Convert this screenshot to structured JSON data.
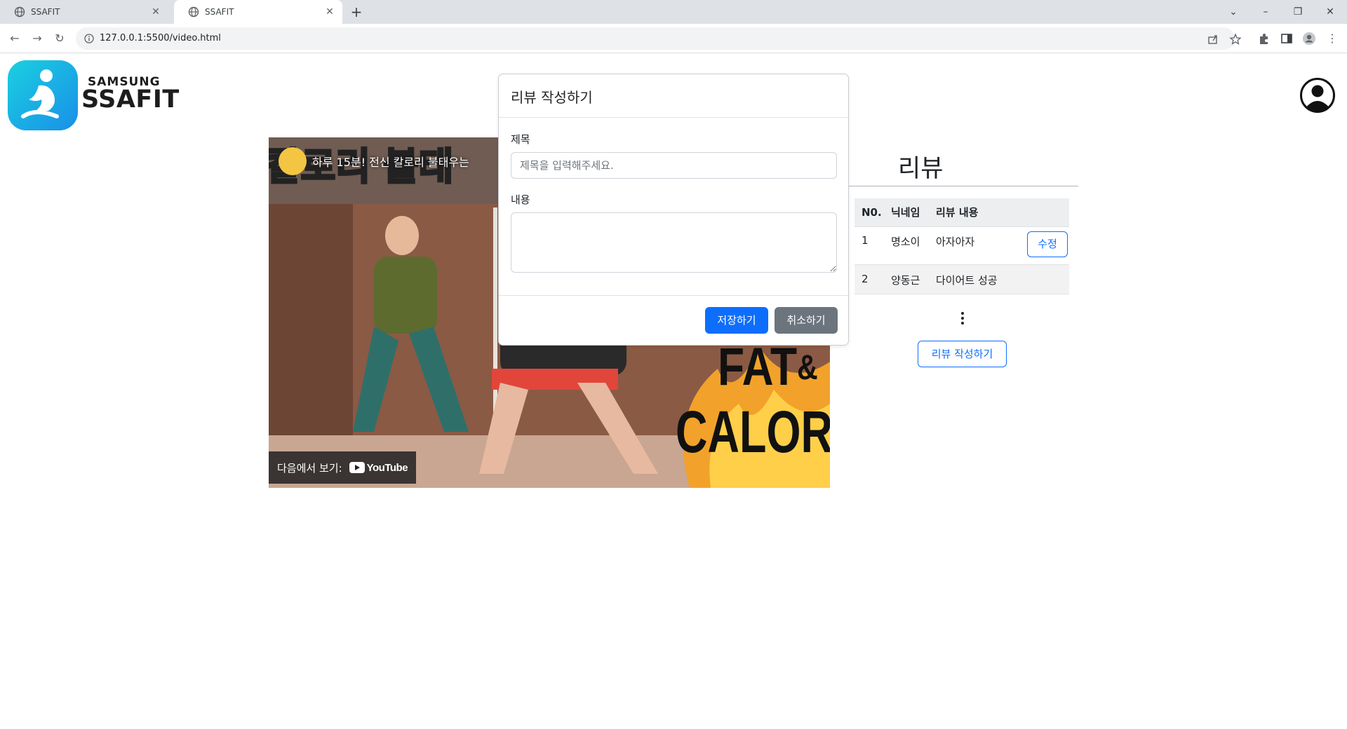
{
  "browser": {
    "tabs": [
      {
        "label": "SSAFIT",
        "active": false
      },
      {
        "label": "SSAFIT",
        "active": true
      }
    ],
    "url": "127.0.0.1:5500/video.html"
  },
  "header": {
    "brand_small": "SAMSUNG",
    "brand_big": "SSAFIT"
  },
  "video": {
    "title": "하루 15분! 전신 칼로리 불태우는",
    "overlay_line1": "FAT",
    "overlay_amp": "&",
    "overlay_line2": "CALORIE",
    "watch_on_label": "다음에서 보기:",
    "youtube_label": "YouTube"
  },
  "review": {
    "heading": "리뷰",
    "columns": [
      "N0.",
      "닉네임",
      "리뷰 내용"
    ],
    "rows": [
      {
        "no": "1",
        "nickname": "명소이",
        "content": "아자아자",
        "action": "수정"
      },
      {
        "no": "2",
        "nickname": "양동근",
        "content": "다이어트 성공"
      }
    ],
    "write_button": "리뷰 작성하기"
  },
  "modal": {
    "title": "리뷰 작성하기",
    "title_label": "제목",
    "title_placeholder": "제목을 입력해주세요.",
    "content_label": "내용",
    "save_button": "저장하기",
    "cancel_button": "취소하기"
  },
  "colors": {
    "primary": "#0d6efd",
    "secondary": "#6c757d",
    "logo_gradient_start": "#1ad0e0",
    "logo_gradient_end": "#1a8fe8"
  }
}
